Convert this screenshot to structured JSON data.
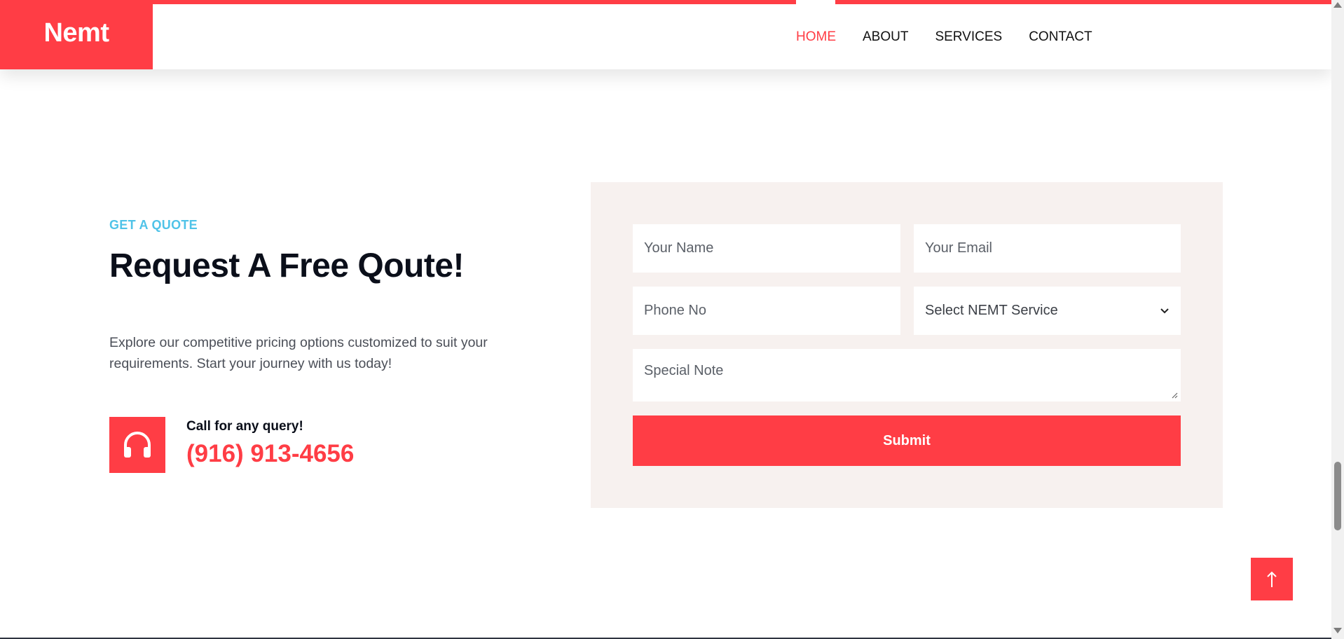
{
  "header": {
    "brand": "Nemt",
    "nav": [
      {
        "label": "HOME",
        "active": true
      },
      {
        "label": "ABOUT",
        "active": false
      },
      {
        "label": "SERVICES",
        "active": false
      },
      {
        "label": "CONTACT",
        "active": false
      }
    ]
  },
  "quote": {
    "eyebrow": "GET A QUOTE",
    "title": "Request A Free Qoute!",
    "description": "Explore our competitive pricing options customized to suit your requirements. Start your journey with us today!",
    "call_label": "Call for any query!",
    "phone": "(916) 913-4656"
  },
  "form": {
    "name_placeholder": "Your Name",
    "email_placeholder": "Your Email",
    "phone_placeholder": "Phone No",
    "service_selected": "Select NEMT Service",
    "note_placeholder": "Special Note",
    "submit_label": "Submit"
  },
  "icons": {
    "call": "headphones-icon",
    "select": "chevron-down-icon",
    "to_top": "arrow-up-icon"
  },
  "colors": {
    "accent": "#ff3d45",
    "eyebrow": "#4fc3e8",
    "panel_bg": "#f7f1ef"
  }
}
